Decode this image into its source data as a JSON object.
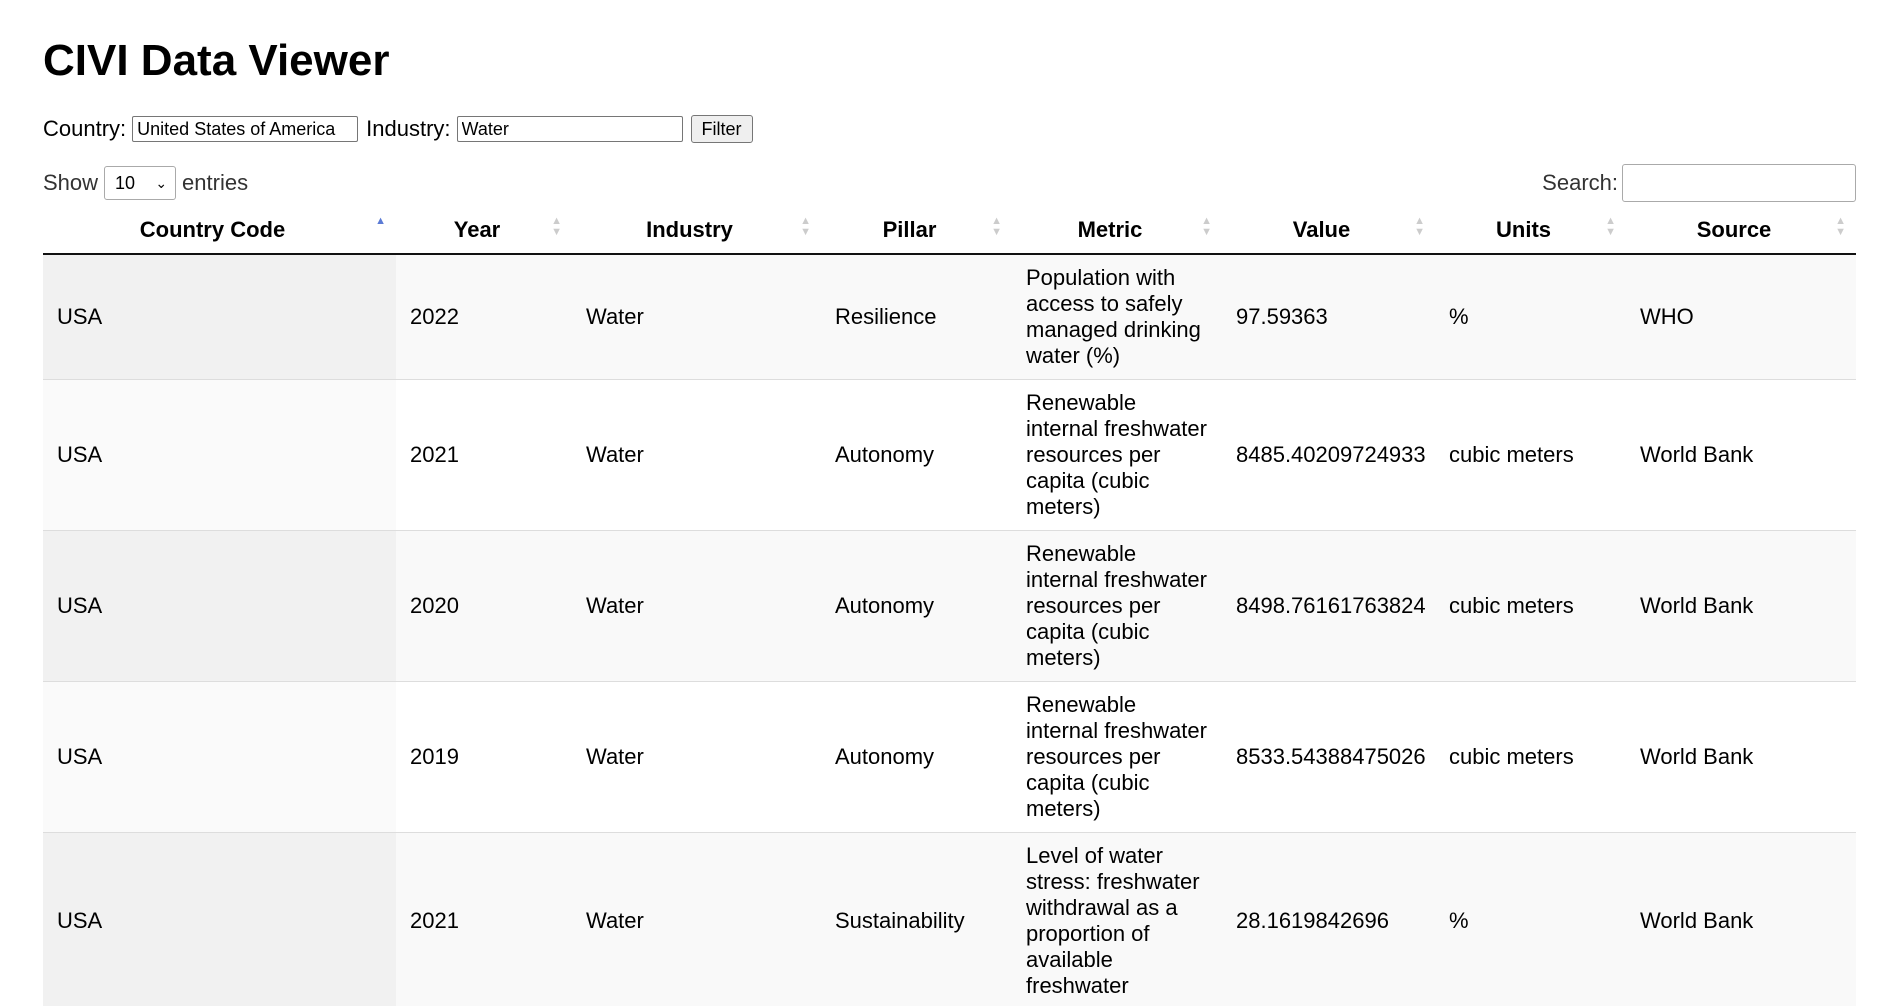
{
  "title": "CIVI Data Viewer",
  "filter": {
    "country_label": "Country:",
    "country_value": "United States of America",
    "industry_label": "Industry:",
    "industry_value": "Water",
    "button_label": "Filter"
  },
  "length": {
    "show_label": "Show",
    "selected": "10",
    "entries_label": "entries"
  },
  "search": {
    "label": "Search:",
    "value": ""
  },
  "table": {
    "headers": [
      "Country Code",
      "Year",
      "Industry",
      "Pillar",
      "Metric",
      "Value",
      "Units",
      "Source"
    ],
    "sorted_column": "Country Code",
    "sort_direction": "ascending",
    "rows": [
      [
        "USA",
        "2022",
        "Water",
        "Resilience",
        "Population with access to safely managed drinking water (%)",
        "97.59363",
        "%",
        "WHO"
      ],
      [
        "USA",
        "2021",
        "Water",
        "Autonomy",
        "Renewable internal freshwater resources per capita (cubic meters)",
        "8485.40209724933",
        "cubic meters",
        "World Bank"
      ],
      [
        "USA",
        "2020",
        "Water",
        "Autonomy",
        "Renewable internal freshwater resources per capita (cubic meters)",
        "8498.76161763824",
        "cubic meters",
        "World Bank"
      ],
      [
        "USA",
        "2019",
        "Water",
        "Autonomy",
        "Renewable internal freshwater resources per capita (cubic meters)",
        "8533.54388475026",
        "cubic meters",
        "World Bank"
      ],
      [
        "USA",
        "2021",
        "Water",
        "Sustainability",
        "Level of water stress: freshwater withdrawal as a proportion of available freshwater",
        "28.1619842696",
        "%",
        "World Bank"
      ]
    ]
  },
  "colors": {
    "sort_active": "#5b7bd5",
    "sort_inactive": "#cccccc",
    "row_odd": "#f9f9f9",
    "sorted_col_odd": "#f1f1f1"
  }
}
